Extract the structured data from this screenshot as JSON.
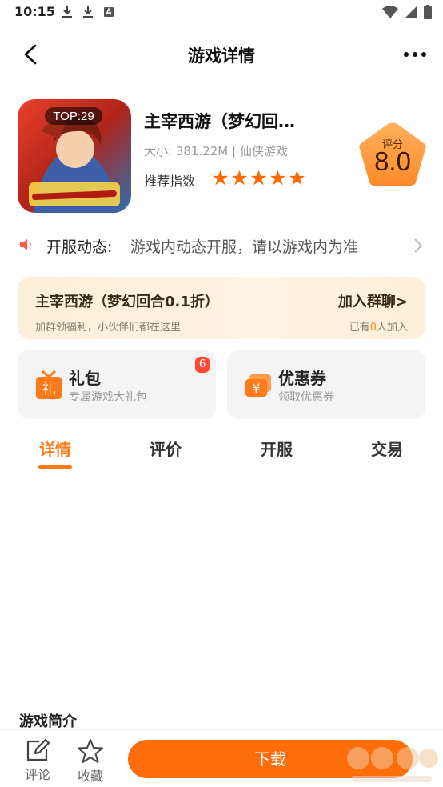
{
  "status_bar": {
    "time": "10:15",
    "icons": [
      "download-icon",
      "download-icon",
      "app-notification-icon",
      "wifi-icon",
      "signal-icon",
      "battery-icon"
    ]
  },
  "header": {
    "title": "游戏详情",
    "back_icon": "back-arrow-icon",
    "more_icon": "more-dots-icon"
  },
  "game": {
    "rank_badge": "TOP:29",
    "name": "主宰西游（梦幻回…",
    "meta": "大小: 381.22M | 仙侠游戏",
    "recommend_label": "推荐指数",
    "stars": 5,
    "score_label": "评分",
    "score": "8.0"
  },
  "notice": {
    "label": "开服动态:",
    "text": "游戏内动态开服，请以游戏内为准"
  },
  "group": {
    "title": "主宰西游（梦幻回合0.1折）",
    "subtitle": "加群领福利，小伙伴们都在这里",
    "join_label": "加入群聊>",
    "count_prefix": "已有",
    "count": "0",
    "count_suffix": "人加入"
  },
  "features": {
    "gift": {
      "title": "礼包",
      "subtitle": "专属游戏大礼包",
      "badge": "6",
      "icon_char": "礼"
    },
    "coupon": {
      "title": "优惠券",
      "subtitle": "领取优惠券",
      "icon_char": "¥"
    }
  },
  "tabs": [
    {
      "label": "详情",
      "active": true
    },
    {
      "label": "评价",
      "active": false
    },
    {
      "label": "开服",
      "active": false
    },
    {
      "label": "交易",
      "active": false
    }
  ],
  "intro": {
    "title": "游戏简介"
  },
  "bottom": {
    "comment_label": "评论",
    "favorite_label": "收藏",
    "download_label": "下载"
  },
  "colors": {
    "accent": "#ff7a12",
    "download": "#ff6d0a",
    "star": "#ff6a00",
    "badge": "#ff4a3a"
  }
}
